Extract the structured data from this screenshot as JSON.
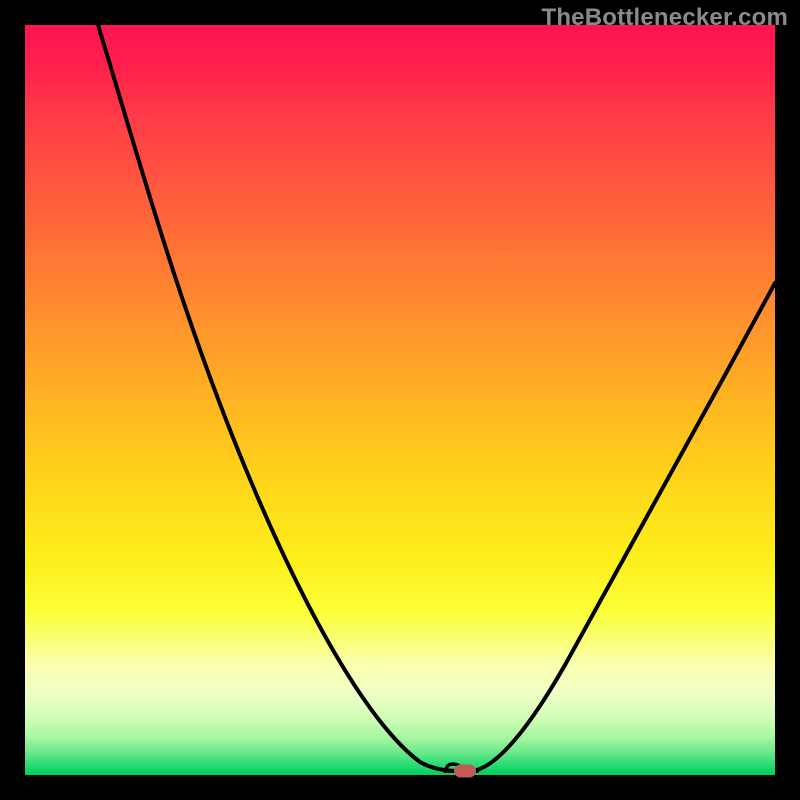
{
  "watermark": "TheBottlenecker.com",
  "chart_data": {
    "type": "line",
    "title": "",
    "xlabel": "",
    "ylabel": "",
    "x_range": [
      0,
      1
    ],
    "y_range": [
      0,
      1
    ],
    "description": "Bottleneck curve — two branches descending to a minimum near x≈0.587 (y≈0 = best match / green); y increases toward red at the edges.",
    "series": [
      {
        "name": "left_branch",
        "x": [
          0.097,
          0.15,
          0.2,
          0.25,
          0.3,
          0.35,
          0.4,
          0.45,
          0.5,
          0.54,
          0.56,
          0.576
        ],
        "y": [
          1.0,
          0.87,
          0.75,
          0.64,
          0.53,
          0.42,
          0.31,
          0.21,
          0.12,
          0.06,
          0.03,
          0.005
        ]
      },
      {
        "name": "trough_flat",
        "x": [
          0.56,
          0.576,
          0.59,
          0.603
        ],
        "y": [
          0.005,
          0.005,
          0.005,
          0.005
        ]
      },
      {
        "name": "right_branch",
        "x": [
          0.597,
          0.64,
          0.7,
          0.76,
          0.82,
          0.88,
          0.94,
          1.0
        ],
        "y": [
          0.005,
          0.06,
          0.16,
          0.28,
          0.4,
          0.51,
          0.6,
          0.658
        ]
      }
    ],
    "marker": {
      "x": 0.587,
      "y": 0.005,
      "color": "#c25b57",
      "shape": "pill"
    },
    "background_gradient_stops": [
      {
        "pos": 0.0,
        "color": "#ff1451"
      },
      {
        "pos": 0.22,
        "color": "#ff5a3e"
      },
      {
        "pos": 0.52,
        "color": "#ffba20"
      },
      {
        "pos": 0.78,
        "color": "#fbff35"
      },
      {
        "pos": 0.92,
        "color": "#d5ffb9"
      },
      {
        "pos": 1.0,
        "color": "#00d05e"
      }
    ],
    "frame_color": "#000000",
    "curve_color": "#000000"
  }
}
